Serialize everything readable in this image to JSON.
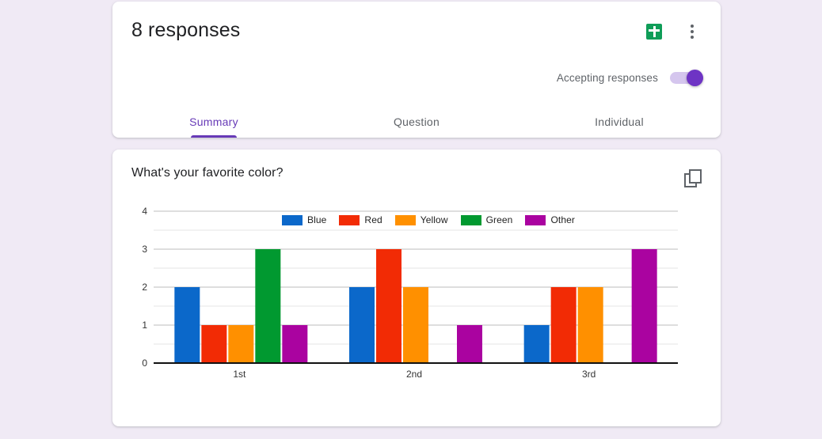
{
  "page": {
    "background_color": "#f0eaf5"
  },
  "header": {
    "responses_count": "8 responses",
    "sheets_icon": "google-sheets-icon",
    "more_icon": "more-vert-icon",
    "accepting_label": "Accepting responses",
    "toggle_state": "on",
    "accent_color": "#673ab7"
  },
  "tabs": [
    {
      "label": "Summary",
      "active": true
    },
    {
      "label": "Question",
      "active": false
    },
    {
      "label": "Individual",
      "active": false
    }
  ],
  "question": {
    "title": "What's your favorite color?",
    "copy_icon": "copy-icon"
  },
  "chart_data": {
    "type": "bar",
    "title": "What's your favorite color?",
    "categories": [
      "1st",
      "2nd",
      "3rd"
    ],
    "series": [
      {
        "name": "Blue",
        "color": "#0b68ca",
        "values": [
          2,
          2,
          1
        ]
      },
      {
        "name": "Red",
        "color": "#f22b05",
        "values": [
          1,
          3,
          2
        ]
      },
      {
        "name": "Yellow",
        "color": "#ff9000",
        "values": [
          1,
          2,
          2
        ]
      },
      {
        "name": "Green",
        "color": "#019930",
        "values": [
          3,
          0,
          0
        ]
      },
      {
        "name": "Other",
        "color": "#aa03a0",
        "values": [
          1,
          1,
          3
        ]
      }
    ],
    "xlabel": "",
    "ylabel": "",
    "ylim": [
      0,
      4
    ],
    "yticks": [
      "0",
      "1",
      "2",
      "3",
      "4"
    ],
    "minor_gridlines": true,
    "legend_position": "top"
  }
}
